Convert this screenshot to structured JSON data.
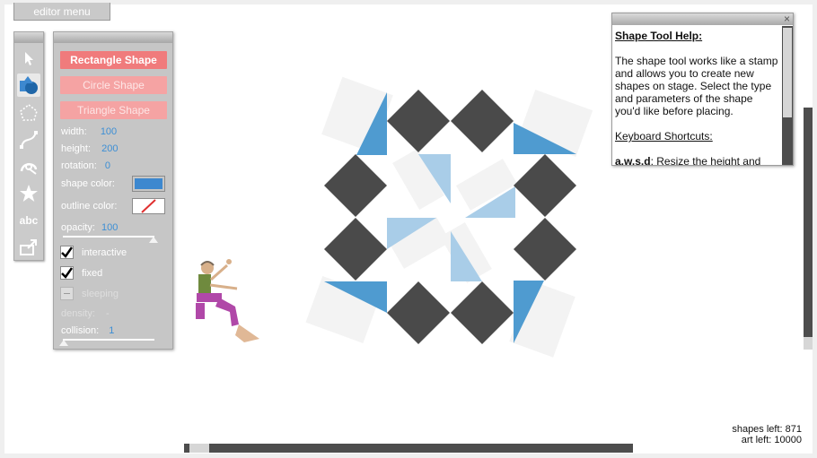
{
  "editor_menu": {
    "label": "editor menu"
  },
  "toolbar": {
    "tools": [
      {
        "name": "select-tool",
        "icon": "arrow-pointer-icon"
      },
      {
        "name": "shape-tool",
        "icon": "shapes-icon",
        "selected": true
      },
      {
        "name": "polygon-tool",
        "icon": "polygon-dashed-icon"
      },
      {
        "name": "joint-tool",
        "icon": "bezier-curve-icon"
      },
      {
        "name": "hinge-tool",
        "icon": "hinge-icon"
      },
      {
        "name": "special-items-tool",
        "icon": "star-icon"
      },
      {
        "name": "text-tool",
        "icon": "abc-text-icon",
        "label": "abc"
      },
      {
        "name": "trigger-tool",
        "icon": "window-arrow-icon"
      }
    ]
  },
  "shape_panel": {
    "buttons": {
      "rectangle": "Rectangle Shape",
      "circle": "Circle Shape",
      "triangle": "Triangle Shape"
    },
    "width": {
      "label": "width:",
      "value": "100"
    },
    "height": {
      "label": "height:",
      "value": "200"
    },
    "rotation": {
      "label": "rotation:",
      "value": "0"
    },
    "shape_color": {
      "label": "shape color:",
      "color": "#3d88cf"
    },
    "outline_color": {
      "label": "outline color:",
      "color": "none"
    },
    "opacity": {
      "label": "opacity:",
      "value": "100",
      "fraction": 1.0
    },
    "interactive": {
      "label": "interactive",
      "checked": true
    },
    "fixed": {
      "label": "fixed",
      "checked": true
    },
    "sleeping": {
      "label": "sleeping",
      "checked": false,
      "disabled": true
    },
    "density": {
      "label": "density:",
      "value": "-"
    },
    "collision": {
      "label": "collision:",
      "value": "1",
      "fraction": 0.0
    }
  },
  "help_panel": {
    "close": "×",
    "title": "Shape Tool Help:",
    "body": "The shape tool works like a stamp and allows you to create new shapes on stage.  Select the type and parameters of the shape you'd like before placing.",
    "shortcuts_title": "Keyboard Shortcuts:",
    "shortcut_keys": "a,w,s,d",
    "shortcut_desc": ": Resize the height and"
  },
  "status": {
    "shapes_left": "shapes left: 871",
    "art_left": "art left: 10000"
  },
  "colors": {
    "dark_diamond": "#4a4a4a",
    "blue": "#4f9bd0",
    "light_blue": "#a9cde8",
    "pale": "#f3f3f3",
    "accent_button": "#f2898a"
  }
}
